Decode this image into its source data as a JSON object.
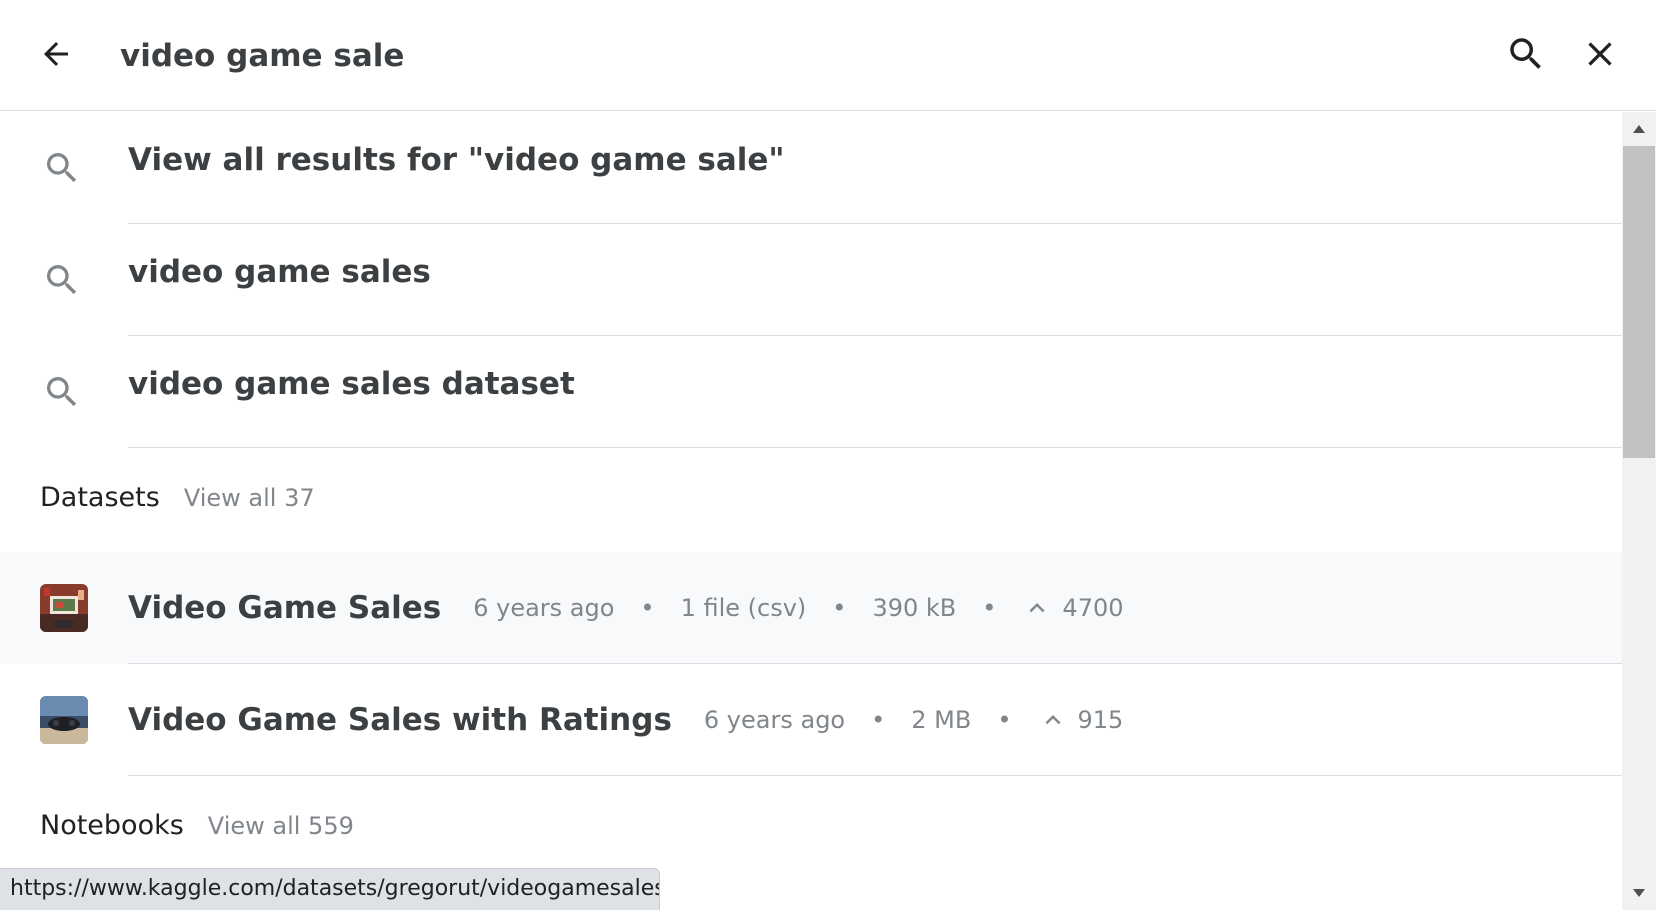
{
  "search": {
    "value": "video game sale",
    "icons": [
      "arrow-back-icon",
      "search-icon",
      "close-icon"
    ]
  },
  "suggestions": [
    {
      "label": "View all results for \"video game sale\"",
      "icon": "search-icon"
    },
    {
      "label": "video game sales",
      "icon": "search-icon"
    },
    {
      "label": "video game sales dataset",
      "icon": "search-icon"
    }
  ],
  "datasets": {
    "title": "Datasets",
    "view_all": "View all 37",
    "items": [
      {
        "title": "Video Game Sales",
        "meta": [
          "6 years ago",
          "1 file (csv)",
          "390 kB"
        ],
        "votes": "4700",
        "icon": "dataset-thumbnail"
      },
      {
        "title": "Video Game Sales with Ratings",
        "meta": [
          "6 years ago",
          "2 MB"
        ],
        "votes": "915",
        "icon": "dataset-thumbnail"
      }
    ]
  },
  "notebooks": {
    "title": "Notebooks",
    "view_all": "View all 559"
  },
  "status_bar": {
    "url": "https://www.kaggle.com/datasets/gregorut/videogamesales"
  },
  "colors": {
    "text": "#3c4043",
    "muted": "#80868b",
    "divider": "#dadce0",
    "hover_row": "#f8f9fa"
  }
}
